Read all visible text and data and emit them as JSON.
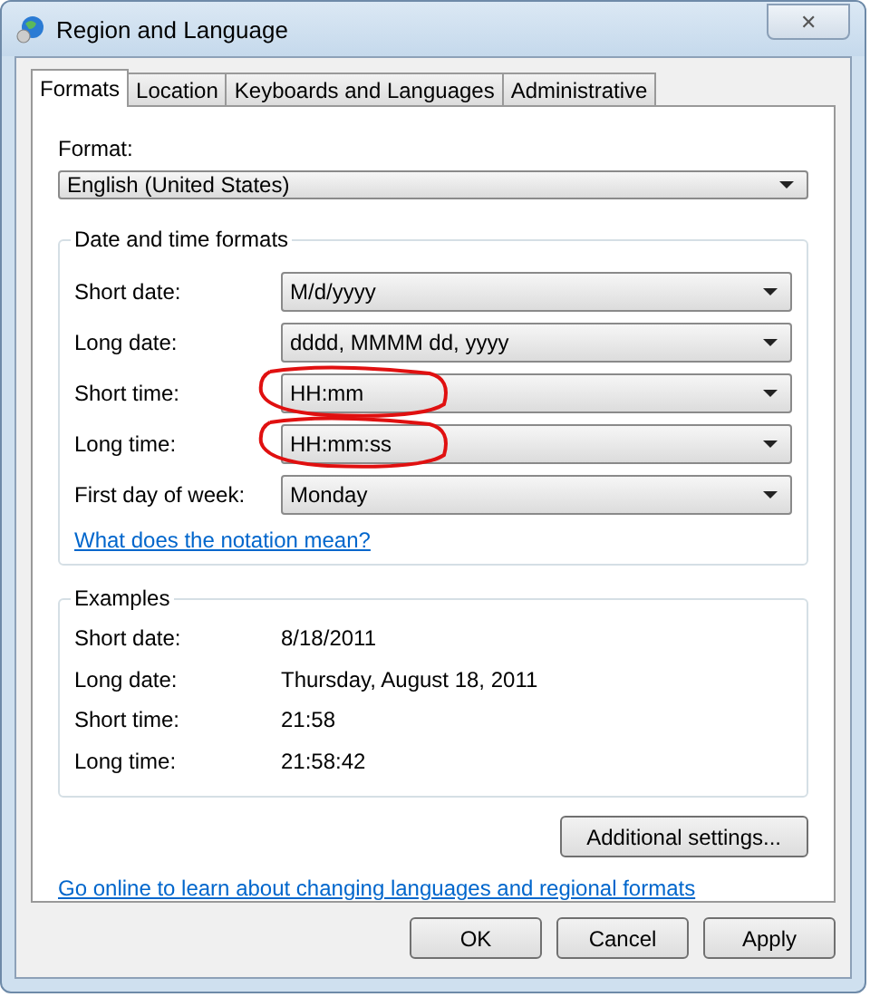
{
  "window": {
    "title": "Region and Language",
    "close": "✕"
  },
  "tabs": [
    {
      "label": "Formats",
      "selected": true
    },
    {
      "label": "Location",
      "selected": false
    },
    {
      "label": "Keyboards and Languages",
      "selected": false
    },
    {
      "label": "Administrative",
      "selected": false
    }
  ],
  "format": {
    "label": "Format:",
    "value": "English (United States)"
  },
  "date_time_formats": {
    "title": "Date and time formats",
    "rows": [
      {
        "label": "Short date:",
        "value": "M/d/yyyy",
        "circled": false
      },
      {
        "label": "Long date:",
        "value": "dddd, MMMM dd, yyyy",
        "circled": false
      },
      {
        "label": "Short time:",
        "value": "HH:mm",
        "circled": true
      },
      {
        "label": "Long time:",
        "value": "HH:mm:ss",
        "circled": true
      },
      {
        "label": "First day of week:",
        "value": "Monday",
        "circled": false
      }
    ],
    "link": "What does the notation mean?"
  },
  "examples": {
    "title": "Examples",
    "rows": [
      {
        "label": "Short date:",
        "value": "8/18/2011"
      },
      {
        "label": "Long date:",
        "value": "Thursday, August 18, 2011"
      },
      {
        "label": "Short time:",
        "value": "21:58"
      },
      {
        "label": "Long time:",
        "value": "21:58:42"
      }
    ]
  },
  "additional_button": "Additional settings...",
  "online_link": "Go online to learn about changing languages and regional formats",
  "buttons": [
    "OK",
    "Cancel",
    "Apply"
  ]
}
